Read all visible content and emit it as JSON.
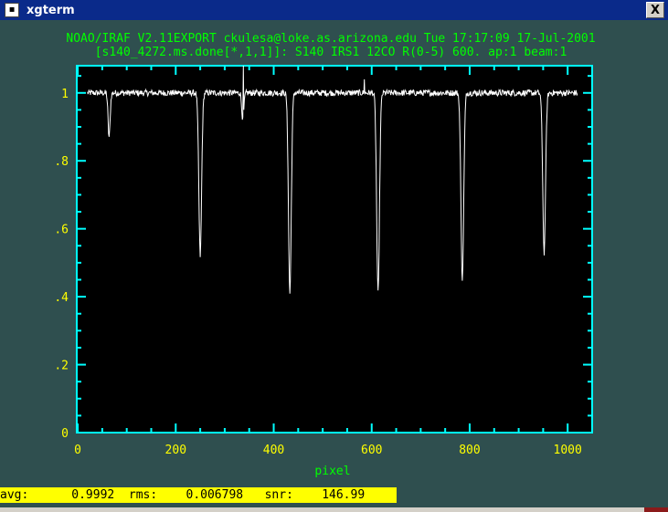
{
  "window": {
    "title": "xgterm",
    "icon": "xterm-window-icon",
    "close_label": "X"
  },
  "header": {
    "line1": "NOAO/IRAF V2.11EXPORT ckulesa@loke.as.arizona.edu Tue 17:17:09 17-Jul-2001",
    "line2": "[s140_4272.ms.done[*,1,1]]: S140 IRS1 12CO R(0-5) 600. ap:1 beam:1"
  },
  "status": {
    "text": "avg:      0.9992  rms:    0.006798   snr:    146.99"
  },
  "colors": {
    "background": "#2f4f4f",
    "plot_bg": "#000000",
    "axes": "#00ffff",
    "tick_labels": "#ffff00",
    "header_text": "#00ff00",
    "data_line": "#ffffff",
    "status_bar": "#ffff00"
  },
  "chart_data": {
    "type": "line",
    "title": "NOAO/IRAF V2.11EXPORT ckulesa@loke.as.arizona.edu Tue 17:17:09 17-Jul-2001",
    "subtitle": "[s140_4272.ms.done[*,1,1]]: S140 IRS1 12CO R(0-5) 600. ap:1 beam:1",
    "xlabel": "pixel",
    "ylabel": "",
    "xlim": [
      -2,
      1050
    ],
    "ylim": [
      0,
      1.08
    ],
    "x_ticks": [
      0,
      200,
      400,
      600,
      800,
      1000
    ],
    "x_tick_labels": [
      "0",
      "200",
      "400",
      "600",
      "800",
      "1000"
    ],
    "y_ticks": [
      0,
      0.2,
      0.4,
      0.6,
      0.8,
      1.0
    ],
    "y_tick_labels": [
      "0",
      ".2",
      ".4",
      ".6",
      ".8",
      "1"
    ],
    "grid": false,
    "series": [
      {
        "x_range": [
          20,
          1020
        ],
        "continuum": 1.0,
        "noise_rms": 0.007,
        "absorption_lines": [
          {
            "center": 64,
            "depth": 0.87,
            "width": 3
          },
          {
            "center": 250,
            "depth": 0.52,
            "width": 4
          },
          {
            "center": 337,
            "depth": 0.92,
            "width": 3
          },
          {
            "center": 433,
            "depth": 0.41,
            "width": 4
          },
          {
            "center": 613,
            "depth": 0.41,
            "width": 4
          },
          {
            "center": 785,
            "depth": 0.45,
            "width": 4
          },
          {
            "center": 952,
            "depth": 0.53,
            "width": 4
          }
        ],
        "emission_spikes": [
          {
            "center": 338,
            "peak": 1.08
          },
          {
            "center": 585,
            "peak": 1.04
          }
        ]
      }
    ]
  }
}
